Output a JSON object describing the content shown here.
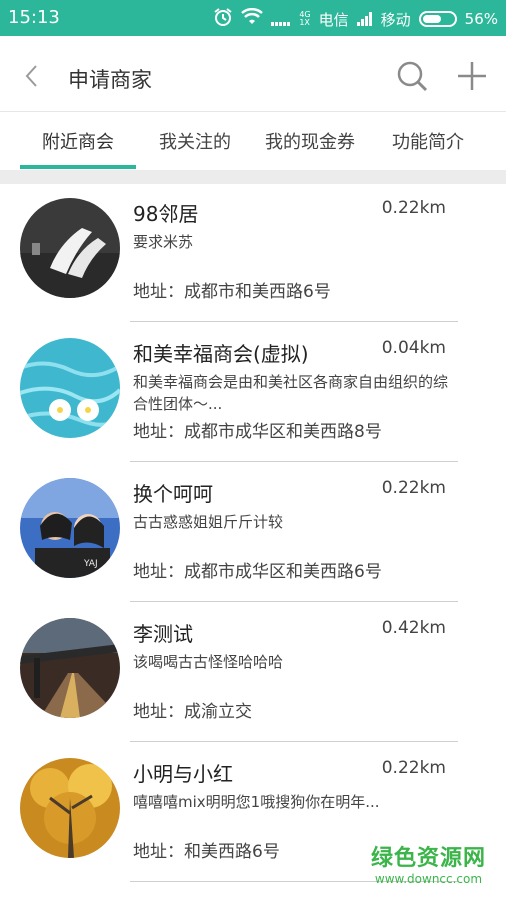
{
  "status_bar": {
    "time": "15:13",
    "carrier1": "电信",
    "carrier2": "移动",
    "battery": "56%",
    "net_badge_top": "4G",
    "net_badge_bottom": "1X",
    "icons": [
      "alarm-icon",
      "wifi-icon",
      "signal-icon",
      "battery-icon"
    ]
  },
  "header": {
    "title": "申请商家",
    "back_icon": "chevron-left-icon",
    "search_icon": "search-icon",
    "add_icon": "plus-icon"
  },
  "tabs": [
    {
      "label": "附近商会",
      "active": true
    },
    {
      "label": "我关注的",
      "active": false
    },
    {
      "label": "我的现金券",
      "active": false
    },
    {
      "label": "功能简介",
      "active": false
    }
  ],
  "colors": {
    "accent": "#2db79a",
    "divider": "#ececec"
  },
  "merchants": [
    {
      "name": "98邻居",
      "distance": "0.22km",
      "desc": "要求米苏",
      "address": "地址：成都市和美西路6号",
      "avatar": "sneakers-photo"
    },
    {
      "name": "和美幸福商会(虚拟)",
      "distance": "0.04km",
      "desc": "和美幸福商会是由和美社区各商家自由组织的综合性团体～...",
      "address": "地址：成都市成华区和美西路8号",
      "avatar": "water-flowers-photo"
    },
    {
      "name": "换个呵呵",
      "distance": "0.22km",
      "desc": "古古惑惑姐姐斤斤计较",
      "address": "地址：成都市成华区和美西路6号",
      "avatar": "two-people-photo"
    },
    {
      "name": "李测试",
      "distance": "0.42km",
      "desc": "该喝喝古古怪怪哈哈哈",
      "address": "地址：成渝立交",
      "avatar": "overpass-photo"
    },
    {
      "name": "小明与小红",
      "distance": "0.22km",
      "desc": "嘻嘻嘻mix明明您1哦搜狗你在明年...",
      "address": "地址：和美西路6号",
      "avatar": "golden-tree-photo"
    }
  ],
  "watermark": {
    "title": "绿色资源网",
    "url": "www.downcc.com"
  }
}
